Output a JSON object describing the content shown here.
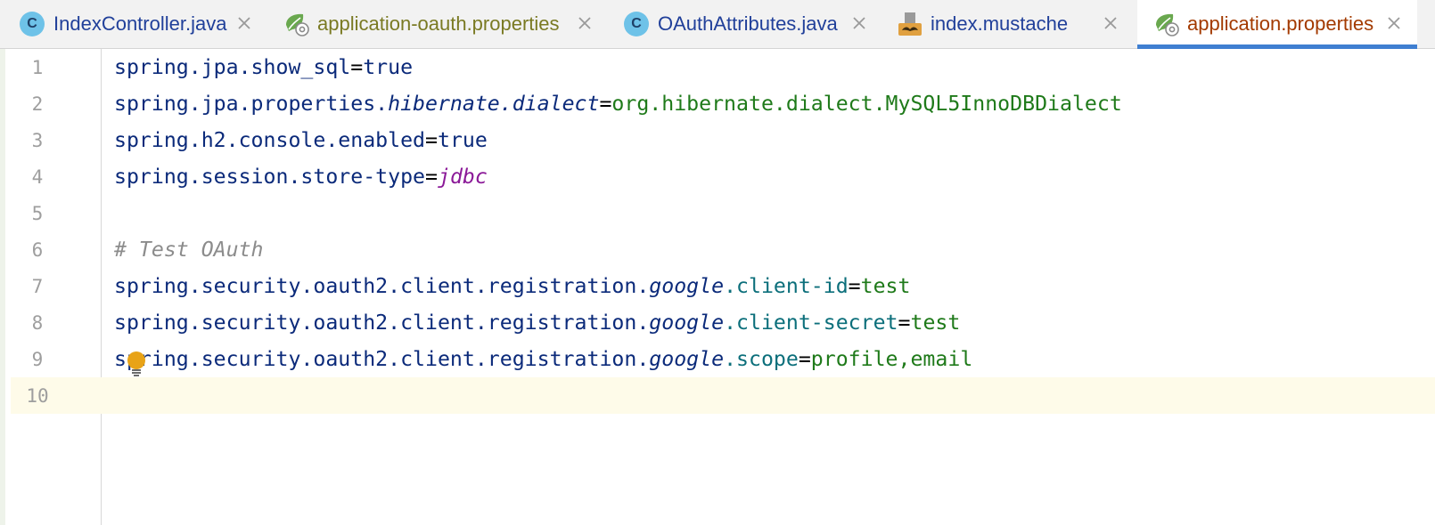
{
  "tabs": [
    {
      "label": "IndexController.java",
      "icon": "java-class-icon",
      "color": "#21409a"
    },
    {
      "label": "application-oauth.properties",
      "icon": "spring-properties-icon",
      "color": "#7a7a23"
    },
    {
      "label": "OAuthAttributes.java",
      "icon": "java-class-icon",
      "color": "#21409a"
    },
    {
      "label": "index.mustache",
      "icon": "mustache-icon",
      "color": "#21409a"
    },
    {
      "label": "application.properties",
      "icon": "spring-properties-icon",
      "color": "#a33a00",
      "active": true
    }
  ],
  "class_icon_letter": "C",
  "line_numbers": [
    "1",
    "2",
    "3",
    "4",
    "5",
    "6",
    "7",
    "8",
    "9",
    "10"
  ],
  "lines": {
    "l1": {
      "key": "spring.jpa.show_sql",
      "eq": "=",
      "value": "true"
    },
    "l2": {
      "key_a": "spring.jpa.properties.",
      "key_b": "hibernate.dialect",
      "eq": "=",
      "value": "org.hibernate.dialect.MySQL5InnoDBDialect"
    },
    "l3": {
      "key": "spring.h2.console.enabled",
      "eq": "=",
      "value": "true"
    },
    "l4": {
      "key": "spring.session.store-type",
      "eq": "=",
      "value": "jdbc"
    },
    "l6": {
      "comment": "# Test OAuth"
    },
    "l7": {
      "key_a": "spring.security.oauth2.client.registration.",
      "key_b": "google",
      "key_c": ".client-id",
      "eq": "=",
      "value": "test"
    },
    "l8": {
      "key_a": "spring.security.oauth2.client.registration.",
      "key_b": "google",
      "key_c": ".client-secret",
      "eq": "=",
      "value": "test"
    },
    "l9": {
      "key_a": "spring.security.oauth2.client.registration.",
      "key_b": "google",
      "key_c": ".scope",
      "eq": "=",
      "value": "profile,email"
    }
  },
  "colors": {
    "active_tab_underline": "#3f7fd1",
    "current_line_bg": "#fefbe9",
    "key": "#0b2a7a",
    "value_green": "#1f7a1a",
    "value_teal": "#0c6f7b",
    "value_purple": "#8b1a98",
    "comment": "#8c8c8c"
  },
  "intention_icon": "lightbulb-icon"
}
